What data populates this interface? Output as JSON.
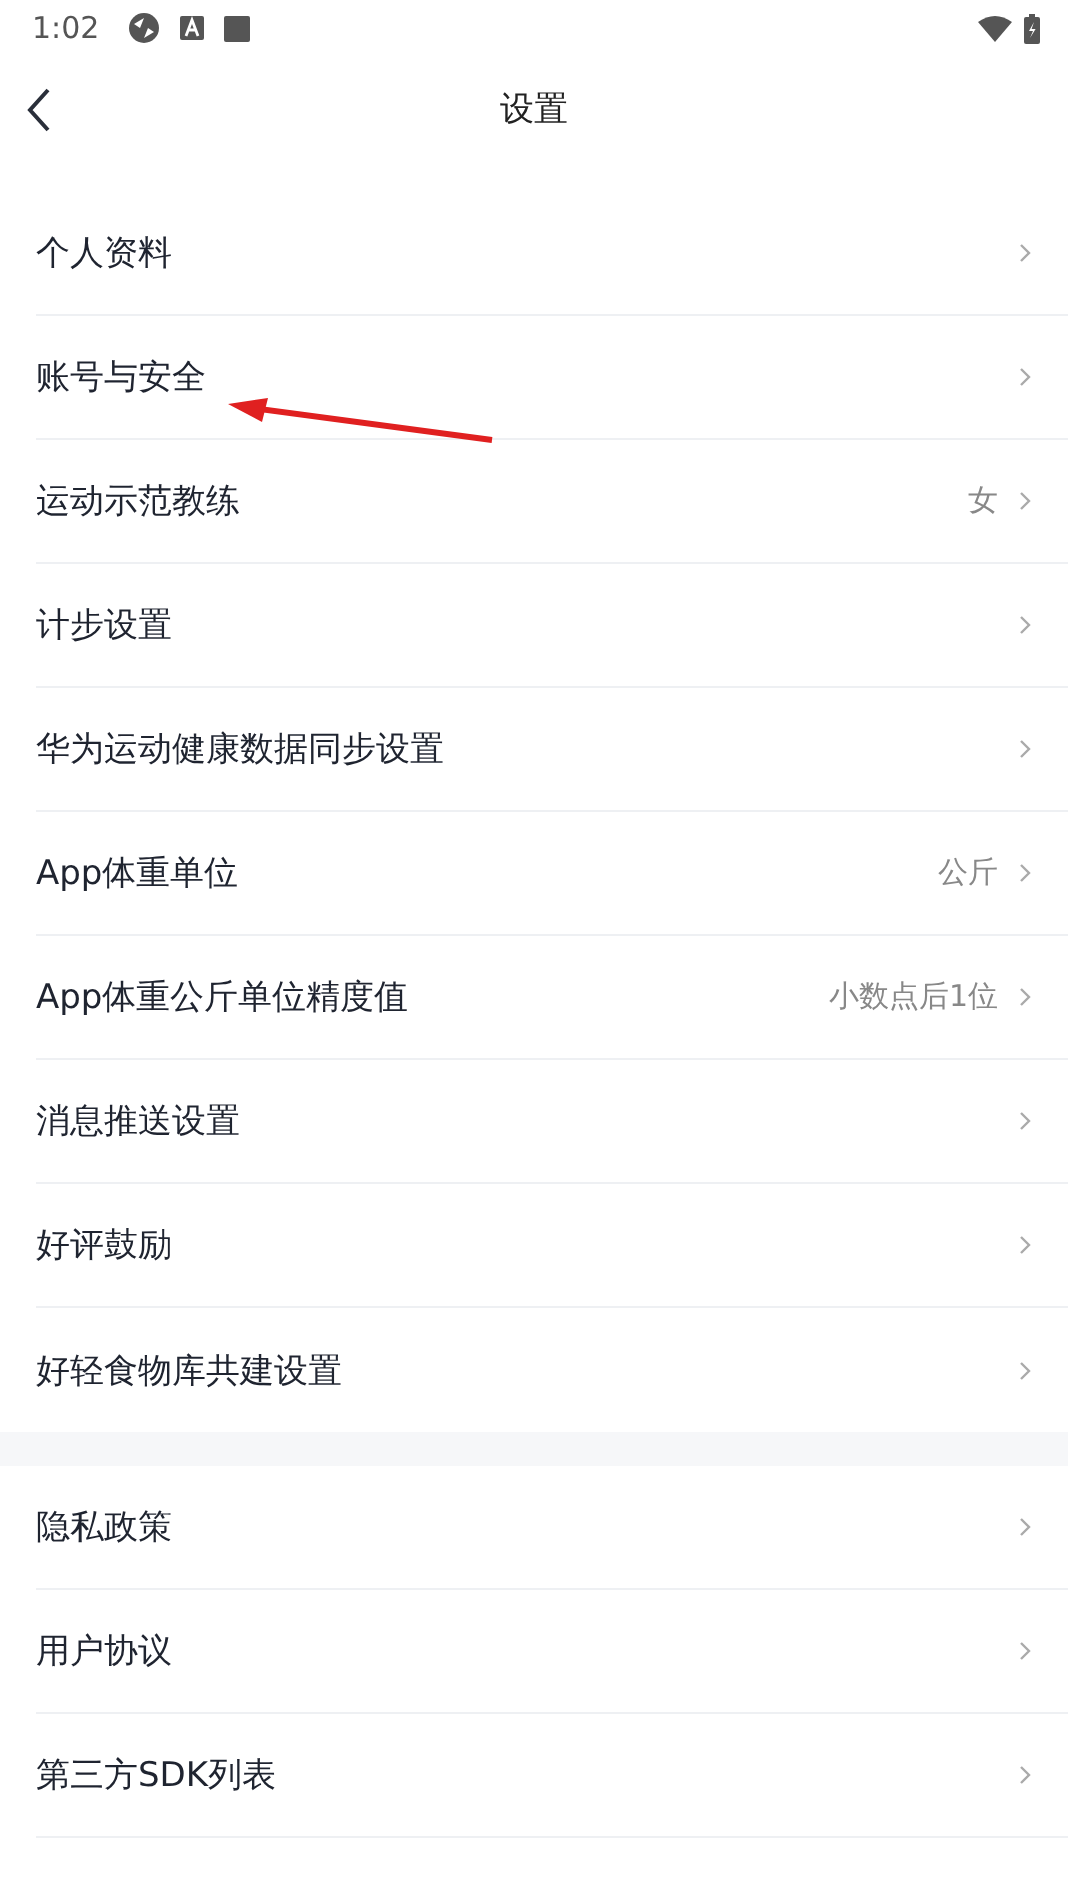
{
  "status_bar": {
    "time": "1:02"
  },
  "header": {
    "title": "设置"
  },
  "groups": [
    {
      "items": [
        {
          "label": "个人资料"
        },
        {
          "label": "账号与安全"
        },
        {
          "label": "运动示范教练",
          "value": "女"
        },
        {
          "label": "计步设置"
        },
        {
          "label": "华为运动健康数据同步设置"
        },
        {
          "label": "App体重单位",
          "value": "公斤"
        },
        {
          "label": "App体重公斤单位精度值",
          "value": "小数点后1位"
        },
        {
          "label": "消息推送设置"
        },
        {
          "label": "好评鼓励"
        },
        {
          "label": "好轻食物库共建设置"
        }
      ]
    },
    {
      "items": [
        {
          "label": "隐私政策"
        },
        {
          "label": "用户协议"
        },
        {
          "label": "第三方SDK列表"
        }
      ]
    }
  ]
}
